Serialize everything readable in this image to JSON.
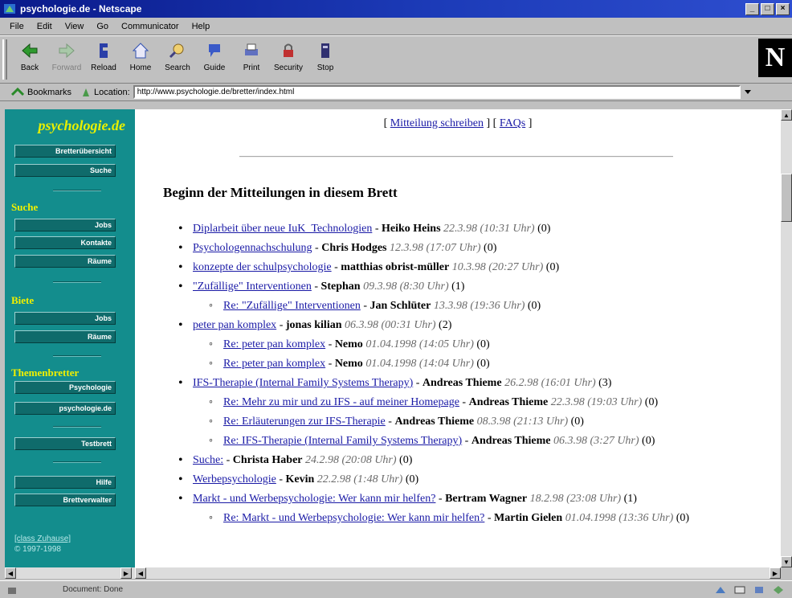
{
  "window": {
    "title": "psychologie.de - Netscape"
  },
  "menu": [
    "File",
    "Edit",
    "View",
    "Go",
    "Communicator",
    "Help"
  ],
  "toolbar": [
    {
      "label": "Back",
      "icon": "back-arrow-icon",
      "disabled": false
    },
    {
      "label": "Forward",
      "icon": "forward-arrow-icon",
      "disabled": true
    },
    {
      "label": "Reload",
      "icon": "reload-icon",
      "disabled": false
    },
    {
      "label": "Home",
      "icon": "home-icon",
      "disabled": false
    },
    {
      "label": "Search",
      "icon": "search-icon",
      "disabled": false
    },
    {
      "label": "Guide",
      "icon": "guide-icon",
      "disabled": false
    },
    {
      "label": "Print",
      "icon": "print-icon",
      "disabled": false
    },
    {
      "label": "Security",
      "icon": "security-lock-icon",
      "disabled": false
    },
    {
      "label": "Stop",
      "icon": "stop-icon",
      "disabled": false
    }
  ],
  "location": {
    "bookmarks_label": "Bookmarks",
    "location_label": "Location:",
    "url": "http://www.psychologie.de/bretter/index.html"
  },
  "sidebar": {
    "logo": "psychologie.de",
    "top_buttons": [
      "Bretterübersicht",
      "Suche"
    ],
    "suche_heading": "Suche",
    "suche_buttons": [
      "Jobs",
      "Kontakte",
      "Räume"
    ],
    "biete_heading": "Biete",
    "biete_buttons": [
      "Jobs",
      "Räume"
    ],
    "themen_heading": "Themenbretter",
    "themen_buttons": [
      "Psychologie",
      "psychologie.de"
    ],
    "testbrett": "Testbrett",
    "bottom_buttons": [
      "Hilfe",
      "Brettverwalter"
    ],
    "footer_link": "[class Zuhause]",
    "copyright": "© 1997-1998"
  },
  "content": {
    "nav_write": "Mitteilung schreiben",
    "nav_faq": "FAQs",
    "heading": "Beginn der Mitteilungen in diesem Brett",
    "messages": [
      {
        "level": 0,
        "title": "Diplarbeit über neue IuK_Technologien",
        "author": "Heiko Heins",
        "date": "22.3.98 (10:31 Uhr)",
        "count": "(0)"
      },
      {
        "level": 0,
        "title": "Psychologennachschulung",
        "author": "Chris Hodges",
        "date": "12.3.98 (17:07 Uhr)",
        "count": "(0)"
      },
      {
        "level": 0,
        "title": "konzepte der schulpsychologie",
        "author": "matthias obrist-müller",
        "date": "10.3.98 (20:27 Uhr)",
        "count": "(0)"
      },
      {
        "level": 0,
        "title": "\"Zufällige\" Interventionen",
        "author": "Stephan",
        "date": "09.3.98 (8:30 Uhr)",
        "count": "(1)"
      },
      {
        "level": 1,
        "title": "Re: \"Zufällige\" Interventionen",
        "author": "Jan Schlüter",
        "date": "13.3.98 (19:36 Uhr)",
        "count": "(0)"
      },
      {
        "level": 0,
        "title": "peter pan komplex",
        "author": "jonas kilian",
        "date": "06.3.98 (00:31 Uhr)",
        "count": "(2)"
      },
      {
        "level": 1,
        "title": "Re: peter pan komplex",
        "author": "Nemo",
        "date": "01.04.1998 (14:05 Uhr)",
        "count": "(0)"
      },
      {
        "level": 1,
        "title": "Re: peter pan komplex",
        "author": "Nemo",
        "date": "01.04.1998 (14:04 Uhr)",
        "count": "(0)"
      },
      {
        "level": 0,
        "title": "IFS-Therapie (Internal Family Systems Therapy)",
        "author": "Andreas Thieme",
        "date": "26.2.98 (16:01 Uhr)",
        "count": "(3)"
      },
      {
        "level": 1,
        "title": "Re: Mehr zu mir und zu IFS - auf meiner Homepage",
        "author": "Andreas Thieme",
        "date": "22.3.98 (19:03 Uhr)",
        "count": "(0)"
      },
      {
        "level": 1,
        "title": "Re: Erläuterungen zur IFS-Therapie",
        "author": "Andreas Thieme",
        "date": "08.3.98 (21:13 Uhr)",
        "count": "(0)"
      },
      {
        "level": 1,
        "title": "Re: IFS-Therapie (Internal Family Systems Therapy)",
        "author": "Andreas Thieme",
        "date": "06.3.98 (3:27 Uhr)",
        "count": "(0)"
      },
      {
        "level": 0,
        "title": "Suche:",
        "author": "Christa Haber",
        "date": "24.2.98 (20:08 Uhr)",
        "count": "(0)"
      },
      {
        "level": 0,
        "title": "Werbepsychologie",
        "author": "Kevin",
        "date": "22.2.98 (1:48 Uhr)",
        "count": "(0)"
      },
      {
        "level": 0,
        "title": "Markt - und Werbepsychologie: Wer kann mir helfen?",
        "author": "Bertram Wagner",
        "date": "18.2.98 (23:08 Uhr)",
        "count": "(1)"
      },
      {
        "level": 1,
        "title": "Re: Markt - und Werbepsychologie: Wer kann mir helfen?",
        "author": "Martin Gielen",
        "date": "01.04.1998 (13:36 Uhr)",
        "count": "(0)"
      }
    ]
  },
  "status": {
    "text": "Document: Done"
  },
  "colors": {
    "sidebar": "#138d8d",
    "link": "#1a1aa6",
    "titlebar": "#0a1a8a",
    "side_heading": "#f0f000"
  }
}
